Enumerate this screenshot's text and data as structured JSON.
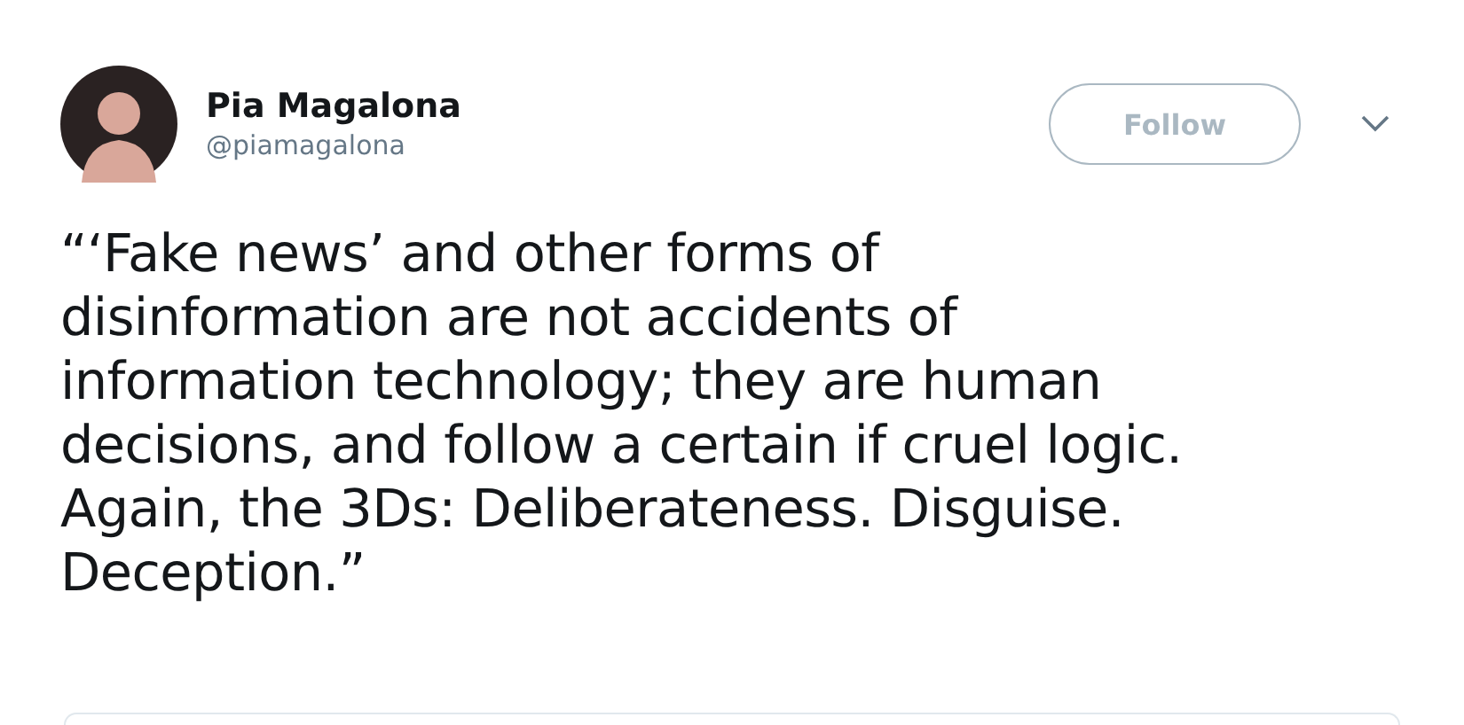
{
  "author": {
    "name": "Pia Magalona",
    "handle": "@piamagalona"
  },
  "follow_button": {
    "label": "Follow"
  },
  "tweet": {
    "text": "“‘Fake news’ and other forms of\ndisinformation are not accidents of\ninformation technology; they are human\ndecisions, and follow a certain if cruel logic.\nAgain, the 3Ds: Deliberateness. Disguise.\nDeception.”"
  }
}
